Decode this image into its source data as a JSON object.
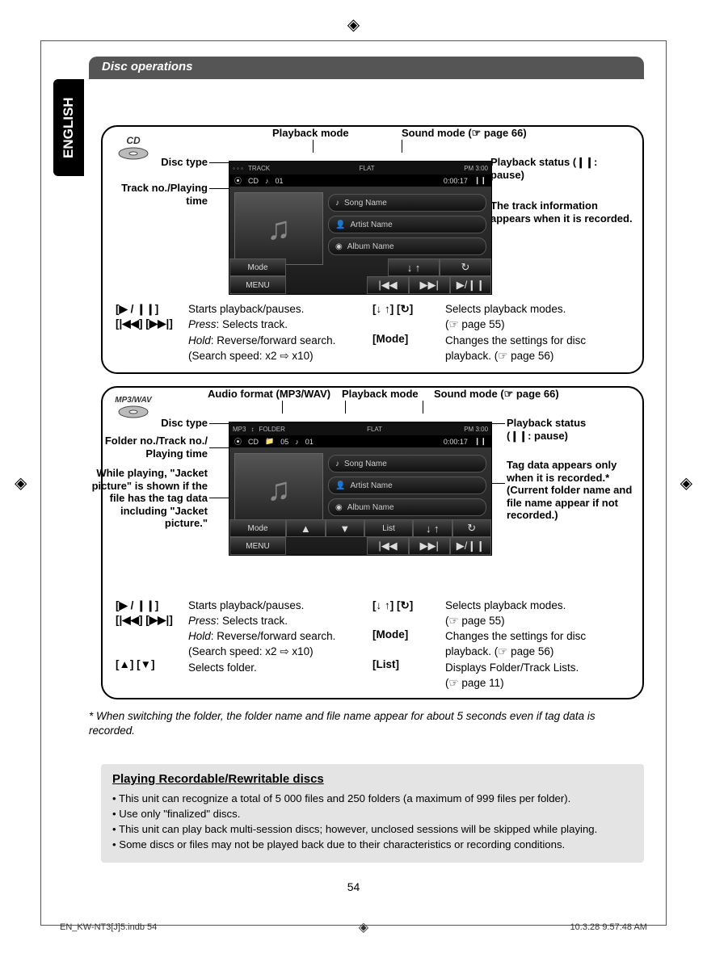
{
  "header": {
    "title": "Disc operations"
  },
  "lang_tab": "ENGLISH",
  "page_number": "54",
  "footer": {
    "file": "EN_KW-NT3[J]5.indb   54",
    "timestamp": "10.3.28   9:57:48 AM"
  },
  "cd": {
    "disc_badge": "CD",
    "callouts": {
      "playback_mode": "Playback mode",
      "sound_mode": "Sound mode (☞ page 66)",
      "disc_type": "Disc type",
      "playback_status": "Playback status (❙❙: pause)",
      "track_playing": "Track no./Playing time",
      "track_info": "The track information appears when it is recorded."
    },
    "screen": {
      "top": {
        "track_lbl": "TRACK",
        "eq": "FLAT",
        "clock": "PM 3:00"
      },
      "info": {
        "disc_icon": "⦿",
        "disc": "CD",
        "note": "♪",
        "track": "01",
        "time": "0:00:17",
        "status": "❙❙"
      },
      "tags": {
        "song": "Song Name",
        "artist": "Artist Name",
        "album": "Album Name"
      },
      "side": {
        "mode": "Mode",
        "menu": "MENU"
      },
      "ctrl": {
        "shuffle": "↓ ↑",
        "repeat": "↻",
        "prev": "|◀◀",
        "next": "▶▶|",
        "play": "▶/❙❙"
      }
    },
    "controls": {
      "left": [
        {
          "key": "[▶ / ❙❙]",
          "lines": [
            "Starts playback/pauses."
          ]
        },
        {
          "key": "[|◀◀] [▶▶|]",
          "lines": [
            "<i>Press</i>: Selects track.",
            "<i>Hold</i>: Reverse/forward search.",
            "(Search speed: x2 ⇨ x10)"
          ]
        }
      ],
      "right": [
        {
          "key": "[↓ ↑] [↻]",
          "lines": [
            "Selects playback modes.",
            "(☞ page 55)"
          ]
        },
        {
          "key": "[<b>Mode</b>]",
          "lines": [
            "Changes the settings for disc",
            "playback. (☞ page 56)"
          ]
        }
      ]
    }
  },
  "mp3": {
    "disc_badge": "MP3/WAV",
    "callouts": {
      "audio_format": "Audio format (MP3/WAV)",
      "playback_mode": "Playback mode",
      "sound_mode": "Sound mode (☞ page 66)",
      "disc_type": "Disc type",
      "playback_status_1": "Playback status",
      "playback_status_2": "(❙❙: pause)",
      "folder_track": "Folder no./Track no./\nPlaying time",
      "jacket": "While playing, \"Jacket picture\" is shown if the file has the tag data including \"Jacket picture.\"",
      "tag_data": "Tag data appears only when it is recorded.* (Current folder name and file name appear if not recorded.)"
    },
    "screen": {
      "top": {
        "fmt": "MP3",
        "folder_lbl": "FOLDER",
        "eq": "FLAT",
        "clock": "PM 3:00"
      },
      "info": {
        "disc_icon": "⦿",
        "disc": "CD",
        "folder_icon": "📁",
        "folder": "05",
        "note": "♪",
        "track": "01",
        "time": "0:00:17",
        "status": "❙❙"
      },
      "tags": {
        "song": "Song Name",
        "artist": "Artist Name",
        "album": "Album Name"
      },
      "side": {
        "mode": "Mode",
        "menu": "MENU"
      },
      "row2": {
        "up": "▲",
        "down": "▼",
        "list": "List",
        "shuffle": "↓ ↑",
        "repeat": "↻"
      },
      "ctrl": {
        "prev": "|◀◀",
        "next": "▶▶|",
        "play": "▶/❙❙"
      }
    },
    "controls": {
      "left": [
        {
          "key": "[▶ / ❙❙]",
          "lines": [
            "Starts playback/pauses."
          ]
        },
        {
          "key": "[|◀◀] [▶▶|]",
          "lines": [
            "<i>Press</i>: Selects track.",
            "<i>Hold</i>: Reverse/forward search.",
            "(Search speed: x2 ⇨ x10)"
          ]
        },
        {
          "key": "[▲] [▼]",
          "lines": [
            "Selects folder."
          ]
        }
      ],
      "right": [
        {
          "key": "[↓ ↑] [↻]",
          "lines": [
            "Selects playback modes.",
            "(☞ page 55)"
          ]
        },
        {
          "key": "[<b>Mode</b>]",
          "lines": [
            "Changes the settings for disc",
            "playback. (☞ page 56)"
          ]
        },
        {
          "key": "[<b>List</b>]",
          "lines": [
            "Displays Folder/Track Lists.",
            "(☞ page 11)"
          ]
        }
      ]
    }
  },
  "footnote": "*  When switching the folder, the folder name and file name appear for about 5 seconds even if tag data is recorded.",
  "info_box": {
    "title": "Playing Recordable/Rewritable discs",
    "items": [
      "This unit can recognize a total of 5 000 files and 250 folders (a maximum of 999 files per folder).",
      "Use only \"finalized\" discs.",
      "This unit can play back multi-session discs; however, unclosed sessions will be skipped while playing.",
      "Some discs or files may not be played back due to their characteristics or recording conditions."
    ]
  }
}
